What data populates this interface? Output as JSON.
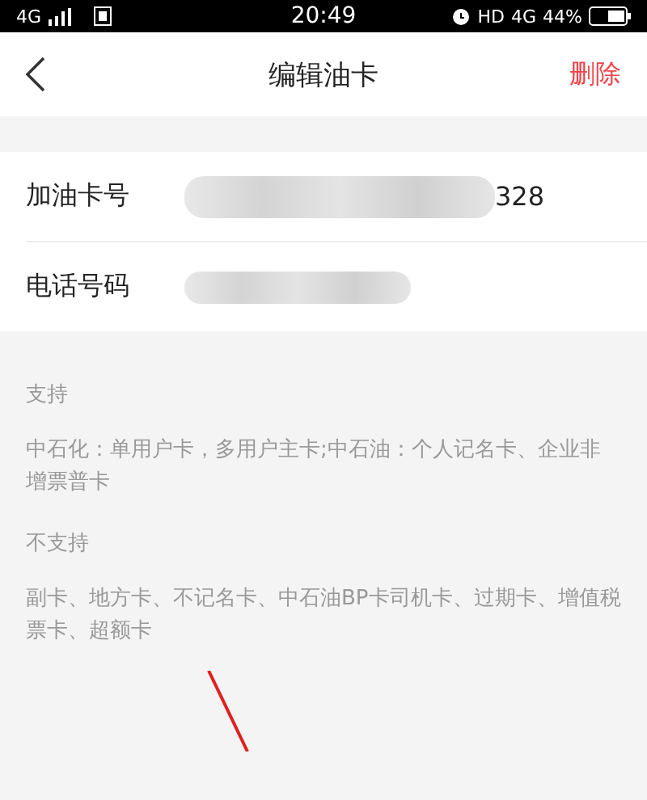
{
  "status_bar": {
    "network": "4G",
    "time": "20:49",
    "right_text": "HD",
    "network_right": "4G",
    "battery": "44%"
  },
  "nav": {
    "title": "编辑油卡",
    "action": "删除"
  },
  "fields": [
    {
      "label": "加油卡号",
      "value": "328",
      "blurred": true
    },
    {
      "label": "电话号码",
      "blurred": true
    }
  ],
  "info": [
    {
      "heading": "支持",
      "text": "中石化：单用户卡，多用户主卡;中石油：个人记名卡、企业非增票普卡"
    },
    {
      "heading": "不支持",
      "text": "副卡、地方卡、不记名卡、中石油BP卡司机卡、过期卡、增值税票卡、超额卡"
    }
  ]
}
